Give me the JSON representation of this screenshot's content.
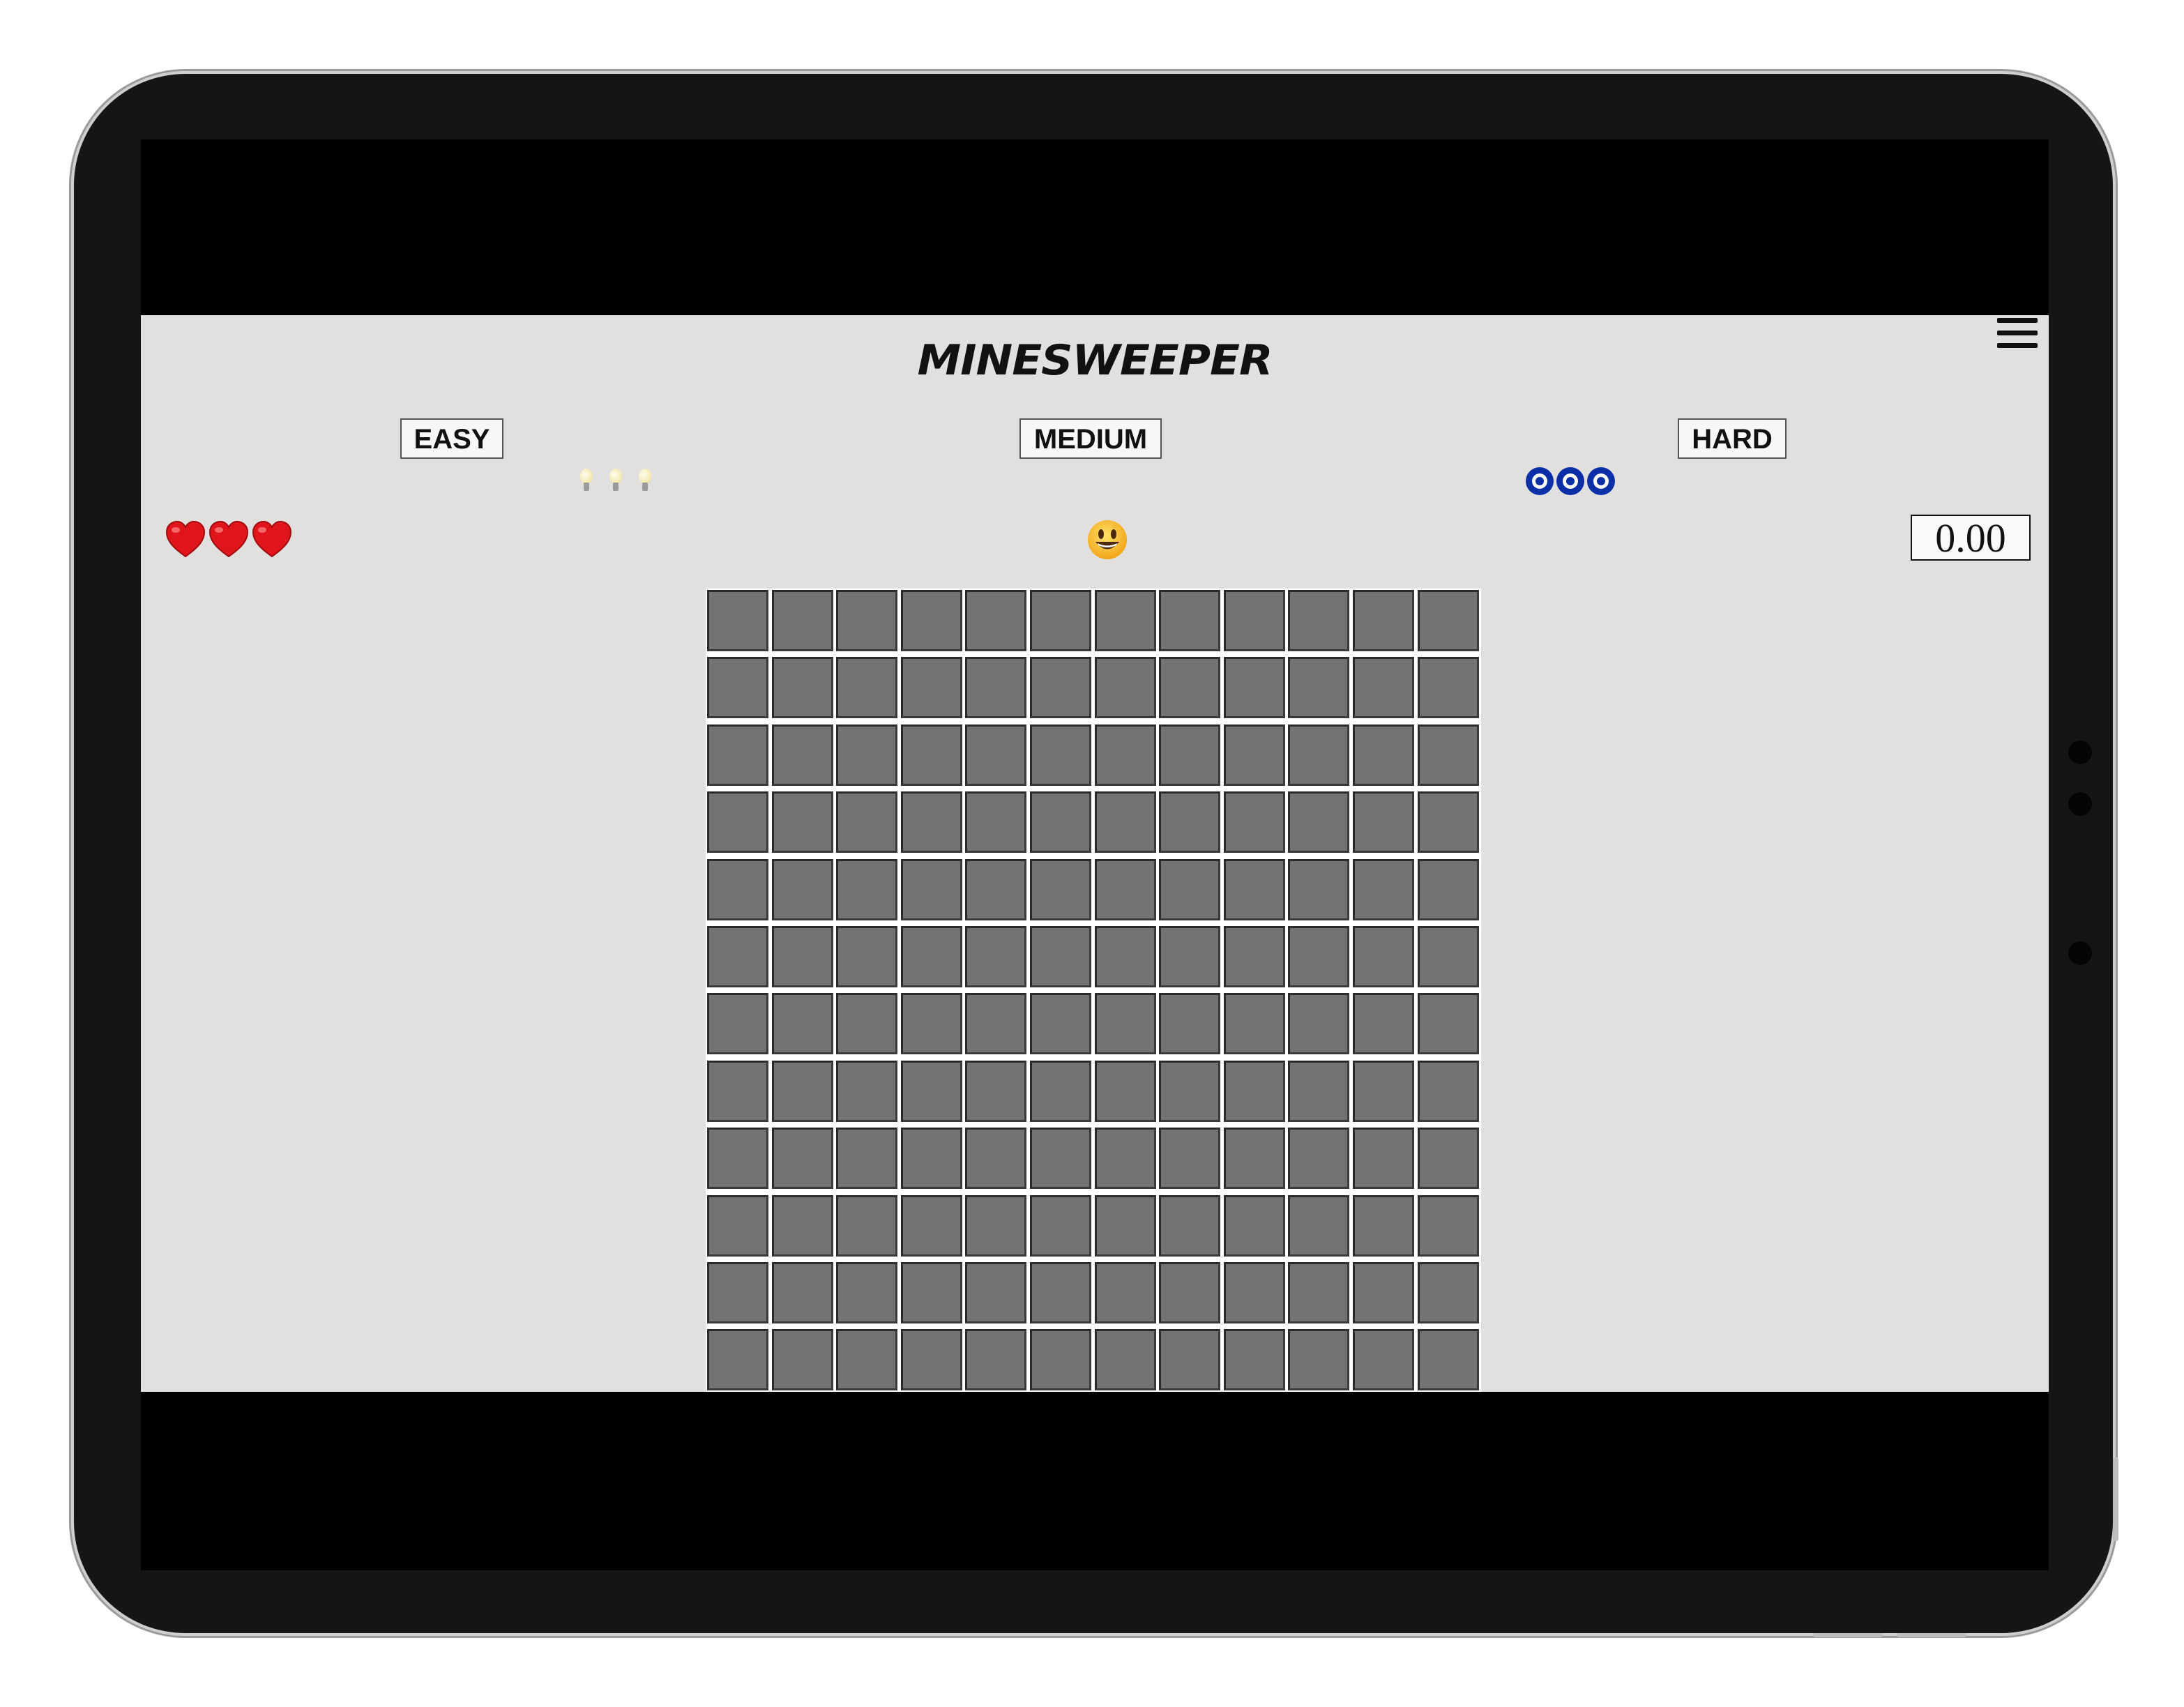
{
  "app": {
    "title": "MINESWEEPER",
    "menu_icon": "hamburger-menu-icon"
  },
  "difficulty": {
    "easy_label": "EASY",
    "medium_label": "MEDIUM",
    "hard_label": "HARD"
  },
  "status": {
    "hints": {
      "icon": "lightbulb-icon",
      "count": 3
    },
    "reveals": {
      "icon": "evil-eye-icon",
      "count": 3
    },
    "lives": {
      "icon": "heart-icon",
      "count": 3
    },
    "face": "smiley-face-icon",
    "timer": "0.00"
  },
  "board": {
    "columns": 12,
    "visible_rows": 12,
    "cell_state": "unrevealed"
  },
  "colors": {
    "app_background": "#e1e0df",
    "cell": "#737373",
    "heart": "#e0151b",
    "eye": "#0b2fa6"
  }
}
